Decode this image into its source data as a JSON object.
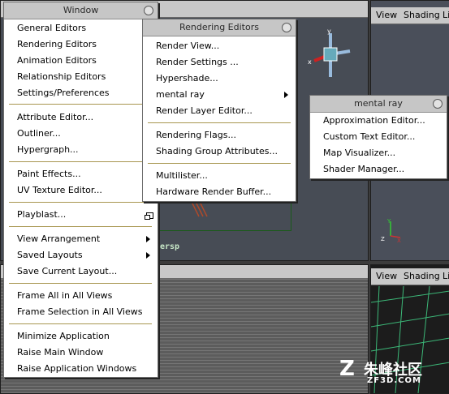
{
  "window_menu": {
    "title": "Window",
    "items": [
      "General Editors",
      "Rendering Editors",
      "Animation Editors",
      "Relationship Editors",
      "Settings/Preferences",
      "Attribute Editor...",
      "Outliner...",
      "Hypergraph...",
      "Paint Effects...",
      "UV Texture Editor...",
      "Playblast...",
      "View Arrangement",
      "Saved Layouts",
      "Save Current Layout...",
      "Frame All in All Views",
      "Frame Selection in All Views",
      "Minimize Application",
      "Raise Main Window",
      "Raise Application Windows"
    ]
  },
  "rendering_menu": {
    "title": "Rendering Editors",
    "items": [
      "Render View...",
      "Render Settings ...",
      "Hypershade...",
      "mental ray",
      "Render Layer Editor...",
      "Rendering Flags...",
      "Shading Group Attributes...",
      "Multilister...",
      "Hardware Render Buffer..."
    ]
  },
  "mentalray_menu": {
    "title": "mental ray",
    "items": [
      "Approximation Editor...",
      "Custom Text Editor...",
      "Map Visualizer...",
      "Shader Manager..."
    ]
  },
  "viewport_top_right": {
    "view": "View",
    "shading": "Shading",
    "lighting": "Lig"
  },
  "viewport_bottom_right": {
    "view": "View",
    "shading": "Shading",
    "lighting": "Lig"
  },
  "persp_label": "ersp",
  "watermark": {
    "brand": "朱峰社区",
    "url": "ZF3D.COM"
  },
  "colors": {
    "menu_bg": "#ffffff",
    "separator": "#a89650",
    "title_bar": "#c6c6c6"
  }
}
